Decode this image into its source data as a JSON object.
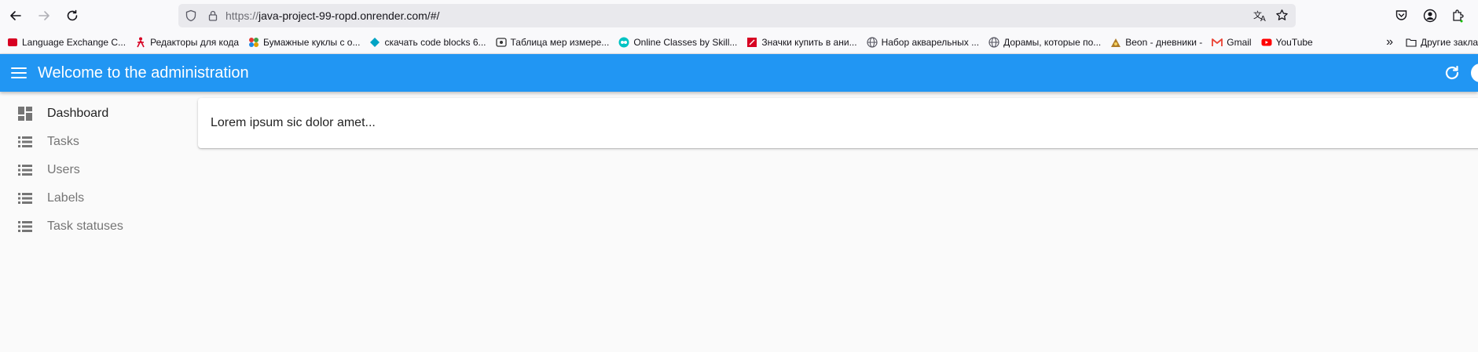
{
  "browser": {
    "url_scheme": "https://",
    "url_rest": "java-project-99-ropd.onrender.com/#/",
    "bookmarks": [
      {
        "label": "Language Exchange C...",
        "icon": "red-book-icon",
        "color": "#d70022"
      },
      {
        "label": "Редакторы для кода",
        "icon": "red-figure-icon",
        "color": "#d70022"
      },
      {
        "label": "Бумажные куклы с о...",
        "icon": "colorful-flower-icon",
        "color": "#e0a000"
      },
      {
        "label": "скачать code blocks 6...",
        "icon": "teal-diamond-icon",
        "color": "#00a3c4"
      },
      {
        "label": "Таблица мер измере...",
        "icon": "eye-box-icon",
        "color": "#333333"
      },
      {
        "label": "Online Classes by Skill...",
        "icon": "skillshare-icon",
        "color": "#00c3c3"
      },
      {
        "label": "Значки купить в ани...",
        "icon": "red-square-icon",
        "color": "#d70022"
      },
      {
        "label": "Набор акварельных ...",
        "icon": "globe-icon",
        "color": "#5b5b66"
      },
      {
        "label": "Дорамы, которые по...",
        "icon": "globe-icon",
        "color": "#5b5b66"
      },
      {
        "label": "Beon - дневники -",
        "icon": "beon-icon",
        "color": "#b07d2a"
      },
      {
        "label": "Gmail",
        "icon": "gmail-icon",
        "color": "#ea4335"
      },
      {
        "label": "YouTube",
        "icon": "youtube-icon",
        "color": "#ff0000"
      }
    ],
    "other_bookmarks": "Другие закла"
  },
  "appbar": {
    "title": "Welcome to the administration",
    "color": "#2196f3"
  },
  "sidebar": {
    "items": [
      {
        "label": "Dashboard",
        "icon": "dashboard-icon",
        "active": true
      },
      {
        "label": "Tasks",
        "icon": "list-icon",
        "active": false
      },
      {
        "label": "Users",
        "icon": "list-icon",
        "active": false
      },
      {
        "label": "Labels",
        "icon": "list-icon",
        "active": false
      },
      {
        "label": "Task statuses",
        "icon": "list-icon",
        "active": false
      }
    ]
  },
  "dashboard": {
    "text": "Lorem ipsum sic dolor amet..."
  }
}
